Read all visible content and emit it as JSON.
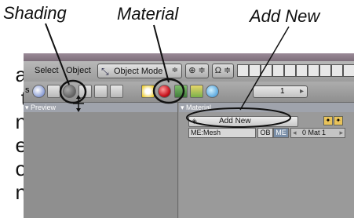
{
  "callouts": {
    "shading": "Shading",
    "material": "Material",
    "add_new": "Add New"
  },
  "left_letters": [
    "a",
    "t",
    "n",
    "e",
    "o",
    "n"
  ],
  "header": {
    "select": "Select",
    "object": "Object",
    "mode_label": "Object Mode",
    "mode_arrow": "≑"
  },
  "toolbar": {
    "frame_value": "1",
    "frame_arrow": "▸"
  },
  "panels": {
    "preview_label": "▾ Preview",
    "material_label": "▾ Material",
    "add_new_label": "Add New",
    "mesh_label": "ME:Mesh",
    "ob_label": "OB",
    "me_label": "ME",
    "mat_label": "0 Mat 1",
    "mat_left": "◂",
    "mat_right": "▸"
  },
  "colors": {
    "material_ball": "#c8141e",
    "shading_ball": "#444444"
  }
}
